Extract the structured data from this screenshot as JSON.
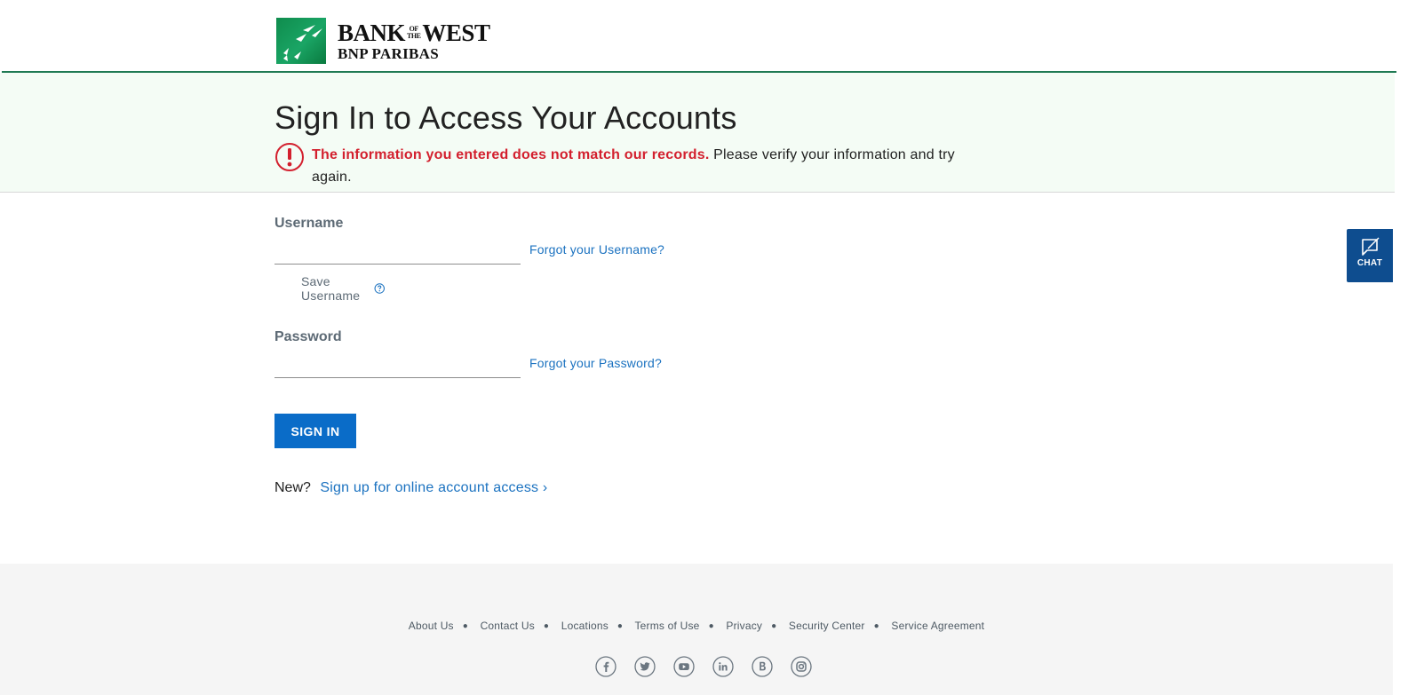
{
  "brand": {
    "logo_line1_left": "BANK",
    "logo_line1_ofthe_top": "OF",
    "logo_line1_ofthe_bottom": "THE",
    "logo_line1_right": "WEST",
    "logo_line2": "BNP PARIBAS",
    "primary_green": "#1f7a53"
  },
  "banner": {
    "title": "Sign In to Access Your Accounts",
    "error_strong": "The information you entered does not match our records.",
    "error_rest": " Please verify your information and try again.",
    "error_color": "#d3202e"
  },
  "form": {
    "username_label": "Username",
    "username_value": "",
    "forgot_username": "Forgot your Username?",
    "save_username_label": "Save Username",
    "password_label": "Password",
    "password_value": "",
    "forgot_password": "Forgot your Password?",
    "signin_button": "SIGN IN",
    "new_label": "New?",
    "signup_link": "Sign up for online account access ›",
    "accent": "#0a6cc8"
  },
  "chat": {
    "label": "CHAT",
    "icon": "chat-icon"
  },
  "footer": {
    "links": [
      "About Us",
      "Contact Us",
      "Locations",
      "Terms of Use",
      "Privacy",
      "Security Center",
      "Service Agreement"
    ],
    "socials": [
      "facebook-icon",
      "twitter-icon",
      "youtube-icon",
      "linkedin-icon",
      "blog-icon",
      "instagram-icon"
    ]
  }
}
